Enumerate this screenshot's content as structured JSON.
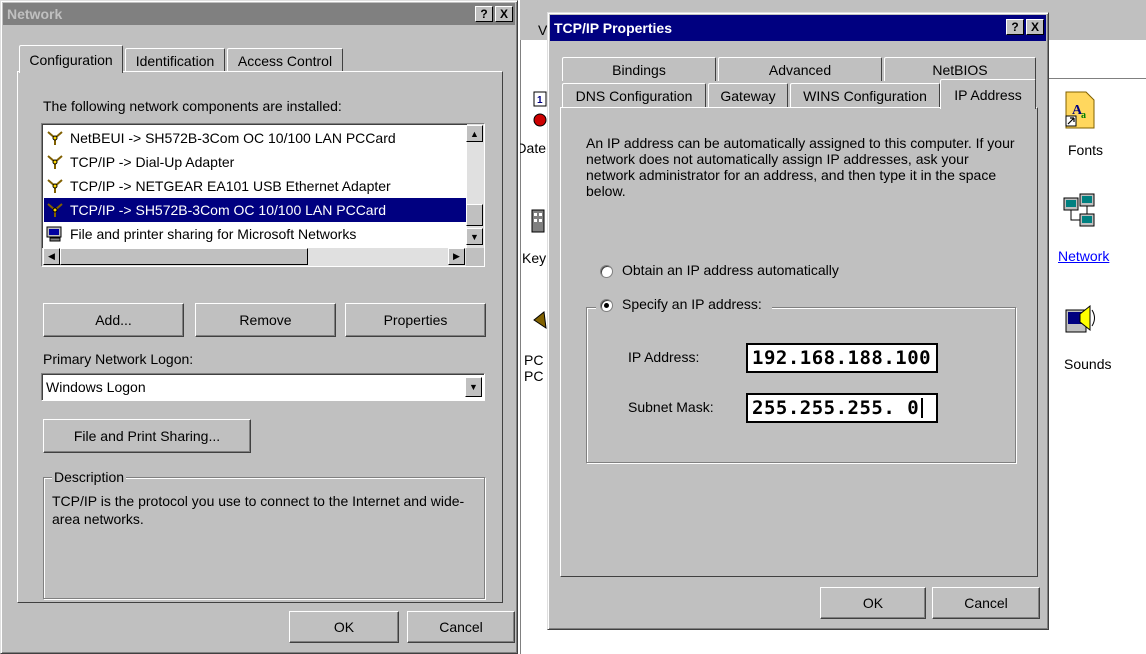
{
  "network": {
    "title": "Network",
    "tabs": [
      "Configuration",
      "Identification",
      "Access Control"
    ],
    "components_label": "The following network components are installed:",
    "components": [
      "NetBEUI -> SH572B-3Com OC 10/100 LAN PCCard",
      "TCP/IP -> Dial-Up Adapter",
      "TCP/IP -> NETGEAR EA101 USB Ethernet Adapter",
      "TCP/IP -> SH572B-3Com OC 10/100 LAN PCCard",
      "File and printer sharing for Microsoft Networks"
    ],
    "selected_index": 3,
    "add_label": "Add...",
    "remove_label": "Remove",
    "properties_label": "Properties",
    "logon_label": "Primary Network Logon:",
    "logon_value": "Windows Logon",
    "file_print_label": "File and Print Sharing...",
    "description_label": "Description",
    "description_text": "TCP/IP is the protocol you use to connect to the Internet and wide-area networks.",
    "ok_label": "OK",
    "cancel_label": "Cancel",
    "help_label": "?",
    "close_label": "X"
  },
  "tcpip": {
    "title": "TCP/IP Properties",
    "tabs_back": [
      "Bindings",
      "Advanced",
      "NetBIOS"
    ],
    "tabs_front": [
      "DNS Configuration",
      "Gateway",
      "WINS Configuration",
      "IP Address"
    ],
    "active_tab": "IP Address",
    "info_text": "An IP address can be automatically assigned to this computer. If your network does not automatically assign IP addresses, ask your network administrator for an address, and then type it in the space below.",
    "obtain_label": "Obtain an IP address automatically",
    "specify_label": "Specify an IP address:",
    "ip_label": "IP Address:",
    "ip_value": "192.168.188.100",
    "subnet_label": "Subnet Mask:",
    "subnet_value": "255.255.255. 0",
    "ok_label": "OK",
    "cancel_label": "Cancel",
    "help_label": "?",
    "close_label": "X"
  },
  "background": {
    "partial_labels": [
      "V",
      "Date",
      "Key",
      "PC",
      "PC"
    ],
    "icons": [
      {
        "label": "Fonts",
        "icon": "fonts-icon"
      },
      {
        "label": "Network",
        "icon": "network-icon"
      },
      {
        "label": "Sounds",
        "icon": "sounds-icon"
      }
    ]
  },
  "colors": {
    "titlebar_active": "#000080",
    "titlebar_inactive": "#808080",
    "face": "#c0c0c0",
    "link": "#0000ff"
  }
}
